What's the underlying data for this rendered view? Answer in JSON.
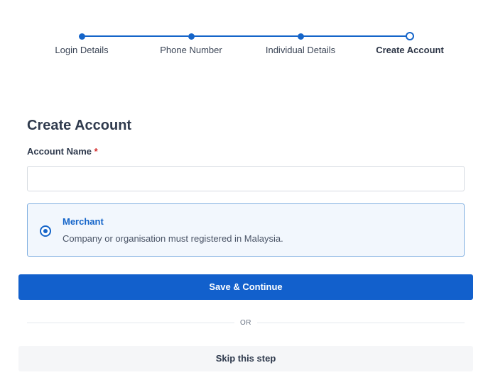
{
  "stepper": {
    "steps": [
      {
        "label": "Login Details",
        "state": "completed"
      },
      {
        "label": "Phone Number",
        "state": "completed"
      },
      {
        "label": "Individual Details",
        "state": "completed"
      },
      {
        "label": "Create Account",
        "state": "current"
      }
    ]
  },
  "form": {
    "title": "Create Account",
    "account_name_label": "Account Name",
    "required_marker": "*",
    "account_name_value": "",
    "option": {
      "title": "Merchant",
      "description": "Company or organisation must registered in Malaysia.",
      "selected": true
    },
    "save_label": "Save & Continue",
    "divider_text": "OR",
    "skip_label": "Skip this step"
  },
  "colors": {
    "accent": "#1565c9",
    "primary_button": "#1260cc",
    "required": "#d32f2f"
  }
}
